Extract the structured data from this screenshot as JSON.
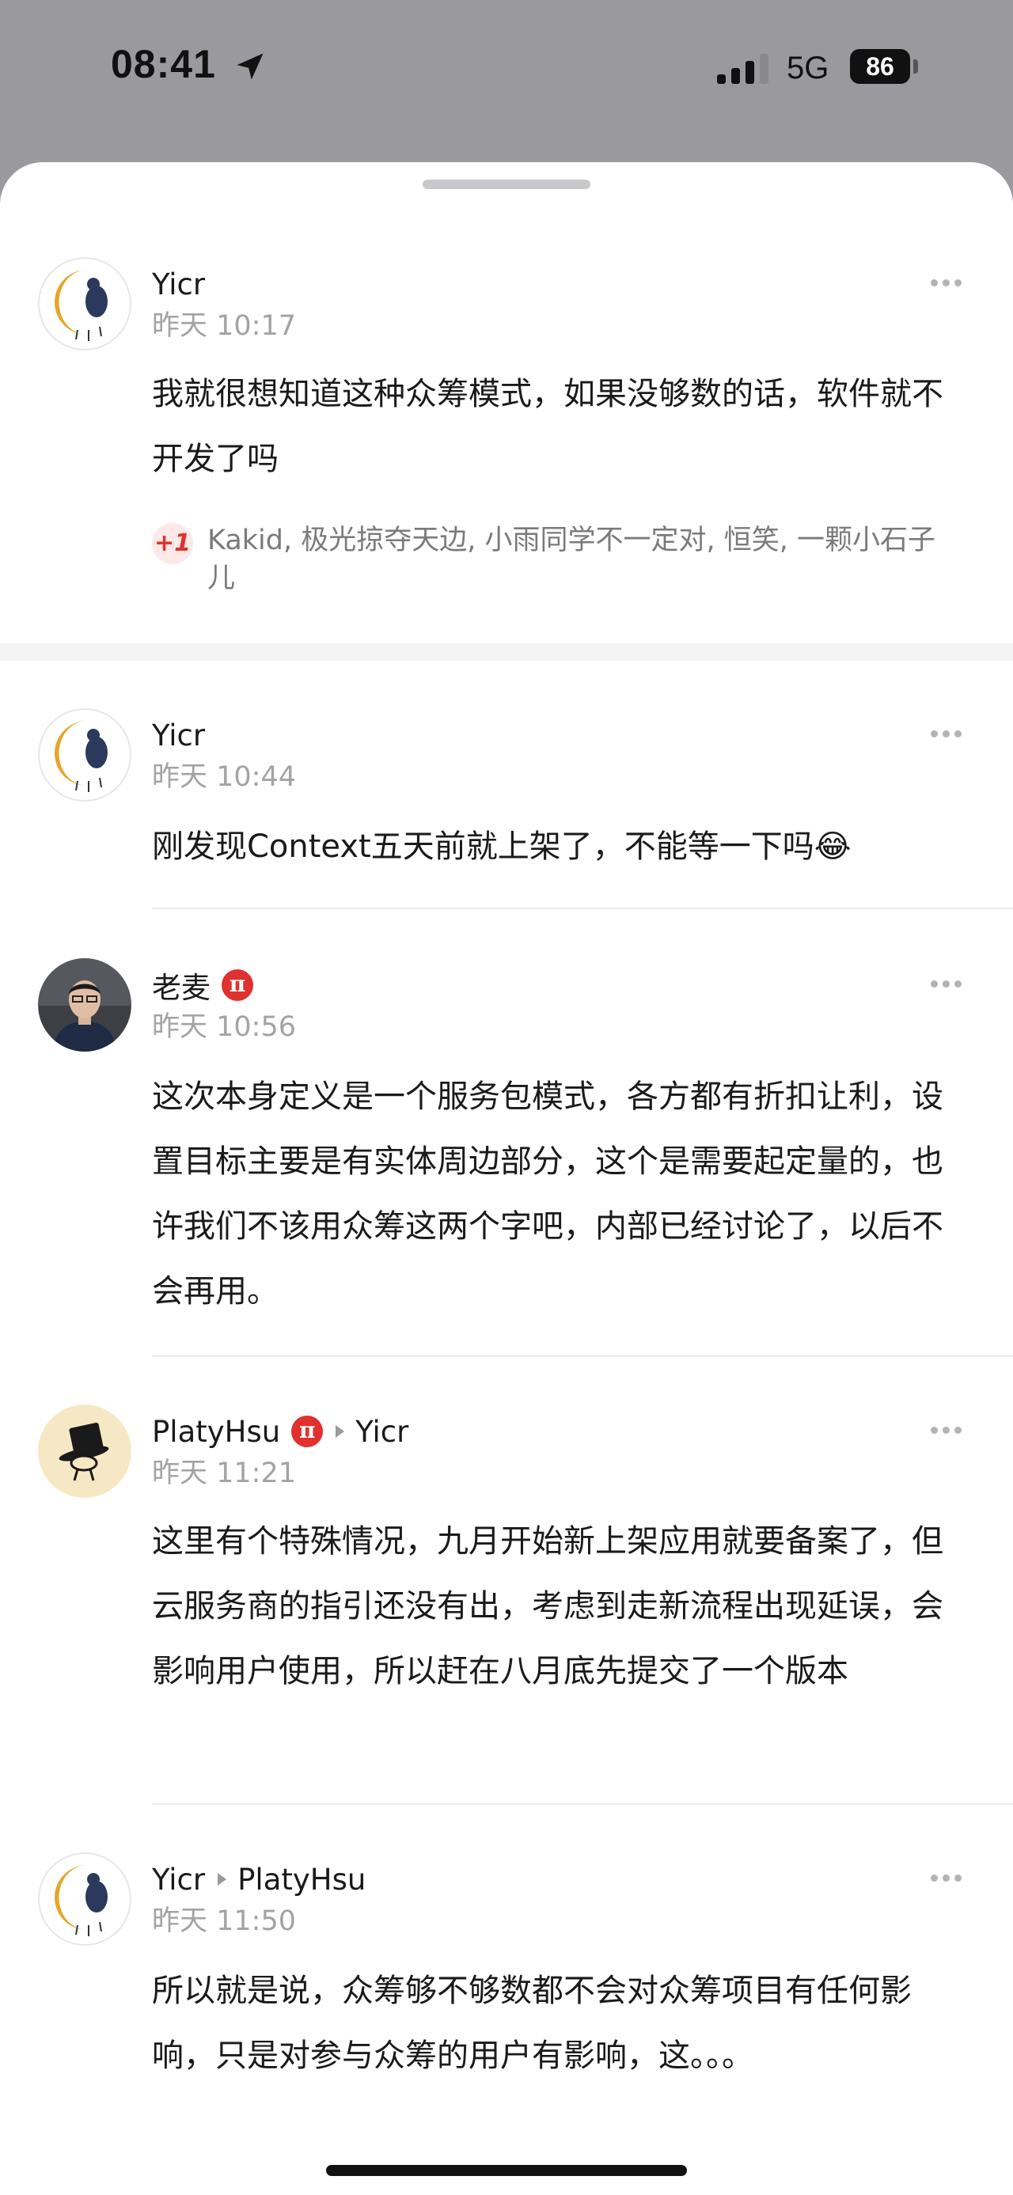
{
  "status_bar": {
    "time": "08:41",
    "network": "5G",
    "battery": "86",
    "icons": [
      "location-arrow-icon",
      "signal-icon",
      "battery-icon"
    ]
  },
  "comments": [
    {
      "author": "Yicr",
      "time": "昨天 10:17",
      "text": "我就很想知道这种众筹模式，如果没够数的话，软件就不开发了吗",
      "likes_label": "+1",
      "likes_text": "Kakid, 极光掠夺天边, 小雨同学不一定对, 恒笑, 一颗小石子儿"
    },
    {
      "author": "Yicr",
      "time": "昨天 10:44",
      "text": "刚发现Context五天前就上架了，不能等一下吗😂"
    },
    {
      "author": "老麦",
      "badge": "π",
      "time": "昨天 10:56",
      "text": "这次本身定义是一个服务包模式，各方都有折扣让利，设置目标主要是有实体周边部分，这个是需要起定量的，也许我们不该用众筹这两个字吧，内部已经讨论了，以后不会再用。"
    },
    {
      "author": "PlatyHsu",
      "badge": "π",
      "reply_to": "Yicr",
      "time": "昨天 11:21",
      "text": "这里有个特殊情况，九月开始新上架应用就要备案了，但云服务商的指引还没有出，考虑到走新流程出现延误，会影响用户使用，所以赶在八月底先提交了一个版本"
    },
    {
      "author": "Yicr",
      "reply_to": "PlatyHsu",
      "time": "昨天 11:50",
      "text": "所以就是说，众筹够不够数都不会对众筹项目有任何影响，只是对参与众筹的用户有影响，这。。。"
    }
  ],
  "colors": {
    "accent_red": "#e0312f",
    "avatar_yellow": "#e6a52a",
    "avatar_navy": "#2b3a5c",
    "timestamp_gray": "#a3a3a3"
  }
}
